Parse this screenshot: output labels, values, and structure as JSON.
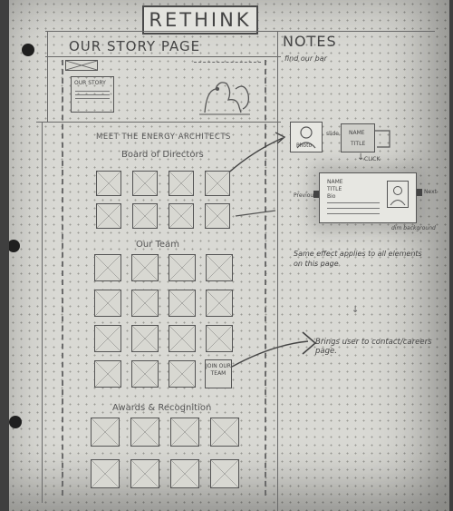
{
  "app_title": "RETHINK",
  "page_header": "OUR STORY PAGE",
  "notes_header": "NOTES",
  "notes_subtitle": "find our bar",
  "banner_box_label": "OUR STORY",
  "section_heading": "MEET THE ENERGY ARCHITECTS",
  "section_board": "Board of Directors",
  "section_team": "Our Team",
  "section_awards": "Awards & Recognition",
  "join_button": "JOIN OUR TEAM",
  "notes": {
    "photo_label": "Photo",
    "slide_label": "slide",
    "name_label": "NAME",
    "title_label": "TITLE",
    "click_label": "CLICK",
    "card_name": "NAME",
    "card_title": "TITLE",
    "card_bio": "Bio",
    "prev_label": "Previous",
    "next_label": "Next",
    "card_caption": "dim background",
    "effect_note": "Same effect applies to all elements on this page",
    "contact_note": "Brings user to contact/careers page."
  },
  "grid_counts": {
    "board_rows": 2,
    "team_rows": 4,
    "awards_rows": 2,
    "columns": 4
  }
}
